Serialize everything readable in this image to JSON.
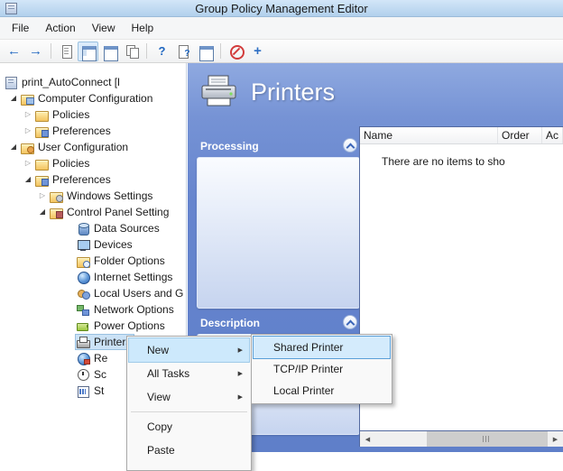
{
  "window": {
    "title": "Group Policy Management Editor"
  },
  "menubar": {
    "items": [
      {
        "label": "File"
      },
      {
        "label": "Action"
      },
      {
        "label": "View"
      },
      {
        "label": "Help"
      }
    ]
  },
  "toolbar": {
    "buttons": [
      {
        "name": "back-arrow"
      },
      {
        "name": "forward-arrow"
      },
      {
        "name": "export-list"
      },
      {
        "name": "show-console-tree",
        "pressed": true
      },
      {
        "name": "standard-window"
      },
      {
        "name": "copy"
      },
      {
        "name": "help"
      },
      {
        "name": "help-doc"
      },
      {
        "name": "new-window"
      },
      {
        "name": "stop"
      },
      {
        "name": "add"
      }
    ]
  },
  "tree": {
    "items": [
      {
        "label": "print_AutoConnect [l",
        "icon": "gpo",
        "level": 0,
        "expander": "none"
      },
      {
        "label": "Computer Configuration",
        "icon": "computer-config",
        "level": 1,
        "expander": "expanded"
      },
      {
        "label": "Policies",
        "icon": "folder",
        "level": 2,
        "expander": "collapsed"
      },
      {
        "label": "Preferences",
        "icon": "folder-pref",
        "level": 2,
        "expander": "collapsed"
      },
      {
        "label": "User Configuration",
        "icon": "user-config",
        "level": 1,
        "expander": "expanded"
      },
      {
        "label": "Policies",
        "icon": "folder",
        "level": 2,
        "expander": "collapsed"
      },
      {
        "label": "Preferences",
        "icon": "folder-pref",
        "level": 2,
        "expander": "expanded"
      },
      {
        "label": "Windows Settings",
        "icon": "windows-settings",
        "level": 3,
        "expander": "collapsed"
      },
      {
        "label": "Control Panel Setting",
        "icon": "control-panel",
        "level": 3,
        "expander": "expanded"
      },
      {
        "label": "Data Sources",
        "icon": "data-sources",
        "level": 4,
        "expander": "none"
      },
      {
        "label": "Devices",
        "icon": "devices",
        "level": 4,
        "expander": "none"
      },
      {
        "label": "Folder Options",
        "icon": "folder-options",
        "level": 4,
        "expander": "none"
      },
      {
        "label": "Internet Settings",
        "icon": "internet-settings",
        "level": 4,
        "expander": "none"
      },
      {
        "label": "Local Users and G",
        "icon": "local-users",
        "level": 4,
        "expander": "none"
      },
      {
        "label": "Network Options",
        "icon": "network-options",
        "level": 4,
        "expander": "none"
      },
      {
        "label": "Power Options",
        "icon": "power-options",
        "level": 4,
        "expander": "none"
      },
      {
        "label": "Printers",
        "icon": "printers",
        "level": 4,
        "expander": "none",
        "selected": true
      },
      {
        "label": "Re",
        "icon": "globe-flag",
        "level": 4,
        "expander": "none"
      },
      {
        "label": "Sc",
        "icon": "clock",
        "level": 4,
        "expander": "none"
      },
      {
        "label": "St",
        "icon": "chart",
        "level": 4,
        "expander": "none"
      }
    ]
  },
  "content": {
    "page_title": "Printers",
    "panels": [
      {
        "title": "Processing"
      },
      {
        "title": "Description"
      }
    ],
    "list": {
      "columns": [
        {
          "label": "Name"
        },
        {
          "label": "Order"
        },
        {
          "label": "Ac"
        }
      ],
      "empty_message": "There are no items to sho"
    }
  },
  "context_menu": {
    "items": [
      {
        "label": "New",
        "has_submenu": true,
        "highlighted": true
      },
      {
        "label": "All Tasks",
        "has_submenu": true
      },
      {
        "label": "View",
        "has_submenu": true
      },
      {
        "label": "Copy"
      },
      {
        "label": "Paste"
      }
    ]
  },
  "submenu": {
    "items": [
      {
        "label": "Shared Printer",
        "highlighted": true
      },
      {
        "label": "TCP/IP Printer"
      },
      {
        "label": "Local Printer"
      }
    ]
  },
  "colors": {
    "titlebar": "#bdd7ee",
    "content_background": "#6383cd",
    "selection_highlight": "#cde9fc"
  }
}
